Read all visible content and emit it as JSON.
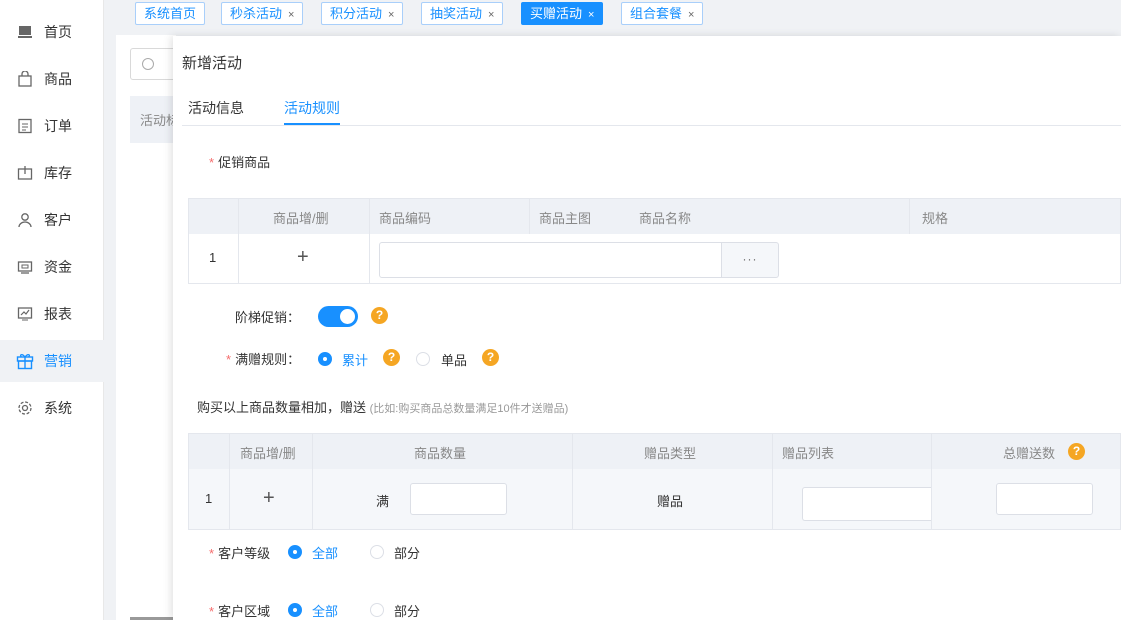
{
  "sidebar": {
    "items": [
      {
        "label": "首页",
        "icon": "home-icon"
      },
      {
        "label": "商品",
        "icon": "bag-icon"
      },
      {
        "label": "订单",
        "icon": "order-icon"
      },
      {
        "label": "库存",
        "icon": "box-icon"
      },
      {
        "label": "客户",
        "icon": "user-icon"
      },
      {
        "label": "资金",
        "icon": "wallet-icon"
      },
      {
        "label": "报表",
        "icon": "chart-icon"
      },
      {
        "label": "营销",
        "icon": "gift-icon"
      },
      {
        "label": "系统",
        "icon": "gear-icon"
      }
    ],
    "active_index": 7
  },
  "tabs": [
    {
      "label": "系统首页",
      "closable": false
    },
    {
      "label": "秒杀活动",
      "closable": true
    },
    {
      "label": "积分活动",
      "closable": true
    },
    {
      "label": "抽奖活动",
      "closable": true
    },
    {
      "label": "买赠活动",
      "closable": true,
      "active": true
    },
    {
      "label": "组合套餐",
      "closable": true
    }
  ],
  "background": {
    "card_label": "活动标"
  },
  "modal": {
    "title": "新增活动",
    "tabs": [
      "活动信息",
      "活动规则"
    ],
    "active_tab": "活动规则",
    "promo_goods_label": "促销商品",
    "goods_table": {
      "headers": [
        "商品增/删",
        "商品编码",
        "商品主图",
        "商品名称",
        "规格"
      ],
      "rows": [
        {
          "index": "1",
          "code": "",
          "more": "···"
        }
      ]
    },
    "ladder_label": "阶梯促销：",
    "ladder_on": true,
    "gift_rule_label": "满赠规则：",
    "gift_rule_options": [
      "累计",
      "单品"
    ],
    "gift_rule_selected": "累计",
    "desc_main": "购买以上商品数量相加，赠送",
    "desc_hint": "(比如:购买商品总数量满足10件才送赠品)",
    "gift_table": {
      "headers": [
        "商品增/删",
        "商品数量",
        "赠品类型",
        "赠品列表",
        "总赠送数"
      ],
      "rows": [
        {
          "index": "1",
          "qty_prefix": "满",
          "gift_type": "赠品"
        }
      ]
    },
    "customer_level_label": "客户等级",
    "customer_level_options": [
      "全部",
      "部分"
    ],
    "customer_region_label": "客户区域",
    "customer_region_options": [
      "全部",
      "部分"
    ],
    "help_glyph": "?",
    "plus_glyph": "+",
    "close_glyph": "×",
    "colors": {
      "accent": "#1890ff",
      "help": "#f5a623",
      "required": "#f56c6c"
    }
  }
}
